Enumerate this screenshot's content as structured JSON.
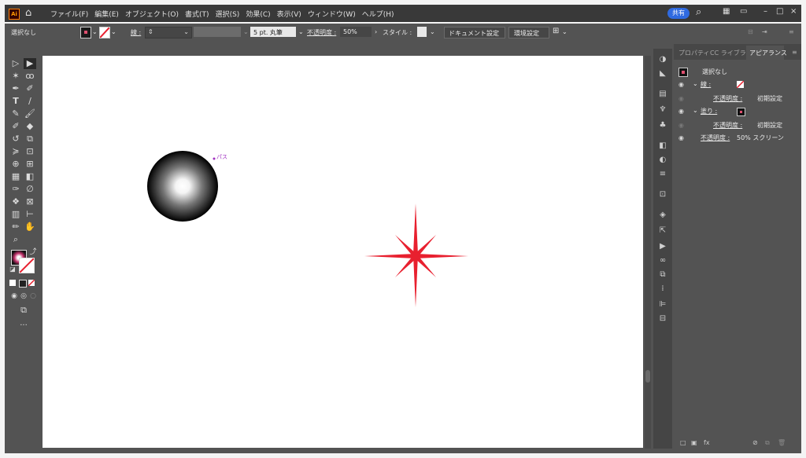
{
  "menubar": {
    "logo": "Ai",
    "menus": [
      "ファイル(F)",
      "編集(E)",
      "オブジェクト(O)",
      "書式(T)",
      "選択(S)",
      "効果(C)",
      "表示(V)",
      "ウィンドウ(W)",
      "ヘルプ(H)"
    ],
    "share_label": "共有"
  },
  "control_bar": {
    "selection_label": "選択なし",
    "stroke_label": "線 :",
    "brush_label": "5 pt. 丸筆",
    "opacity_label": "不透明度 :",
    "opacity_value": "50%",
    "style_label": "スタイル :",
    "doc_settings_label": "ドキュメント設定",
    "preferences_label": "環境設定"
  },
  "canvas": {
    "path_label": "パス"
  },
  "panel": {
    "tabs": [
      "プロパティ",
      "CC ライブラリ",
      "アピアランス"
    ],
    "active_tab_index": 2,
    "title": "選択なし",
    "rows": [
      {
        "label": "線 :",
        "value": ""
      },
      {
        "label": "不透明度 :",
        "value": "初期設定"
      },
      {
        "label": "塗り :",
        "value": ""
      },
      {
        "label": "不透明度 :",
        "value": "初期設定"
      },
      {
        "label": "不透明度 :",
        "value": "50% スクリーン"
      }
    ]
  },
  "colors": {
    "accent": "#2f6ae0",
    "star": "#e8202f",
    "fill_swatch": "#e05070"
  }
}
